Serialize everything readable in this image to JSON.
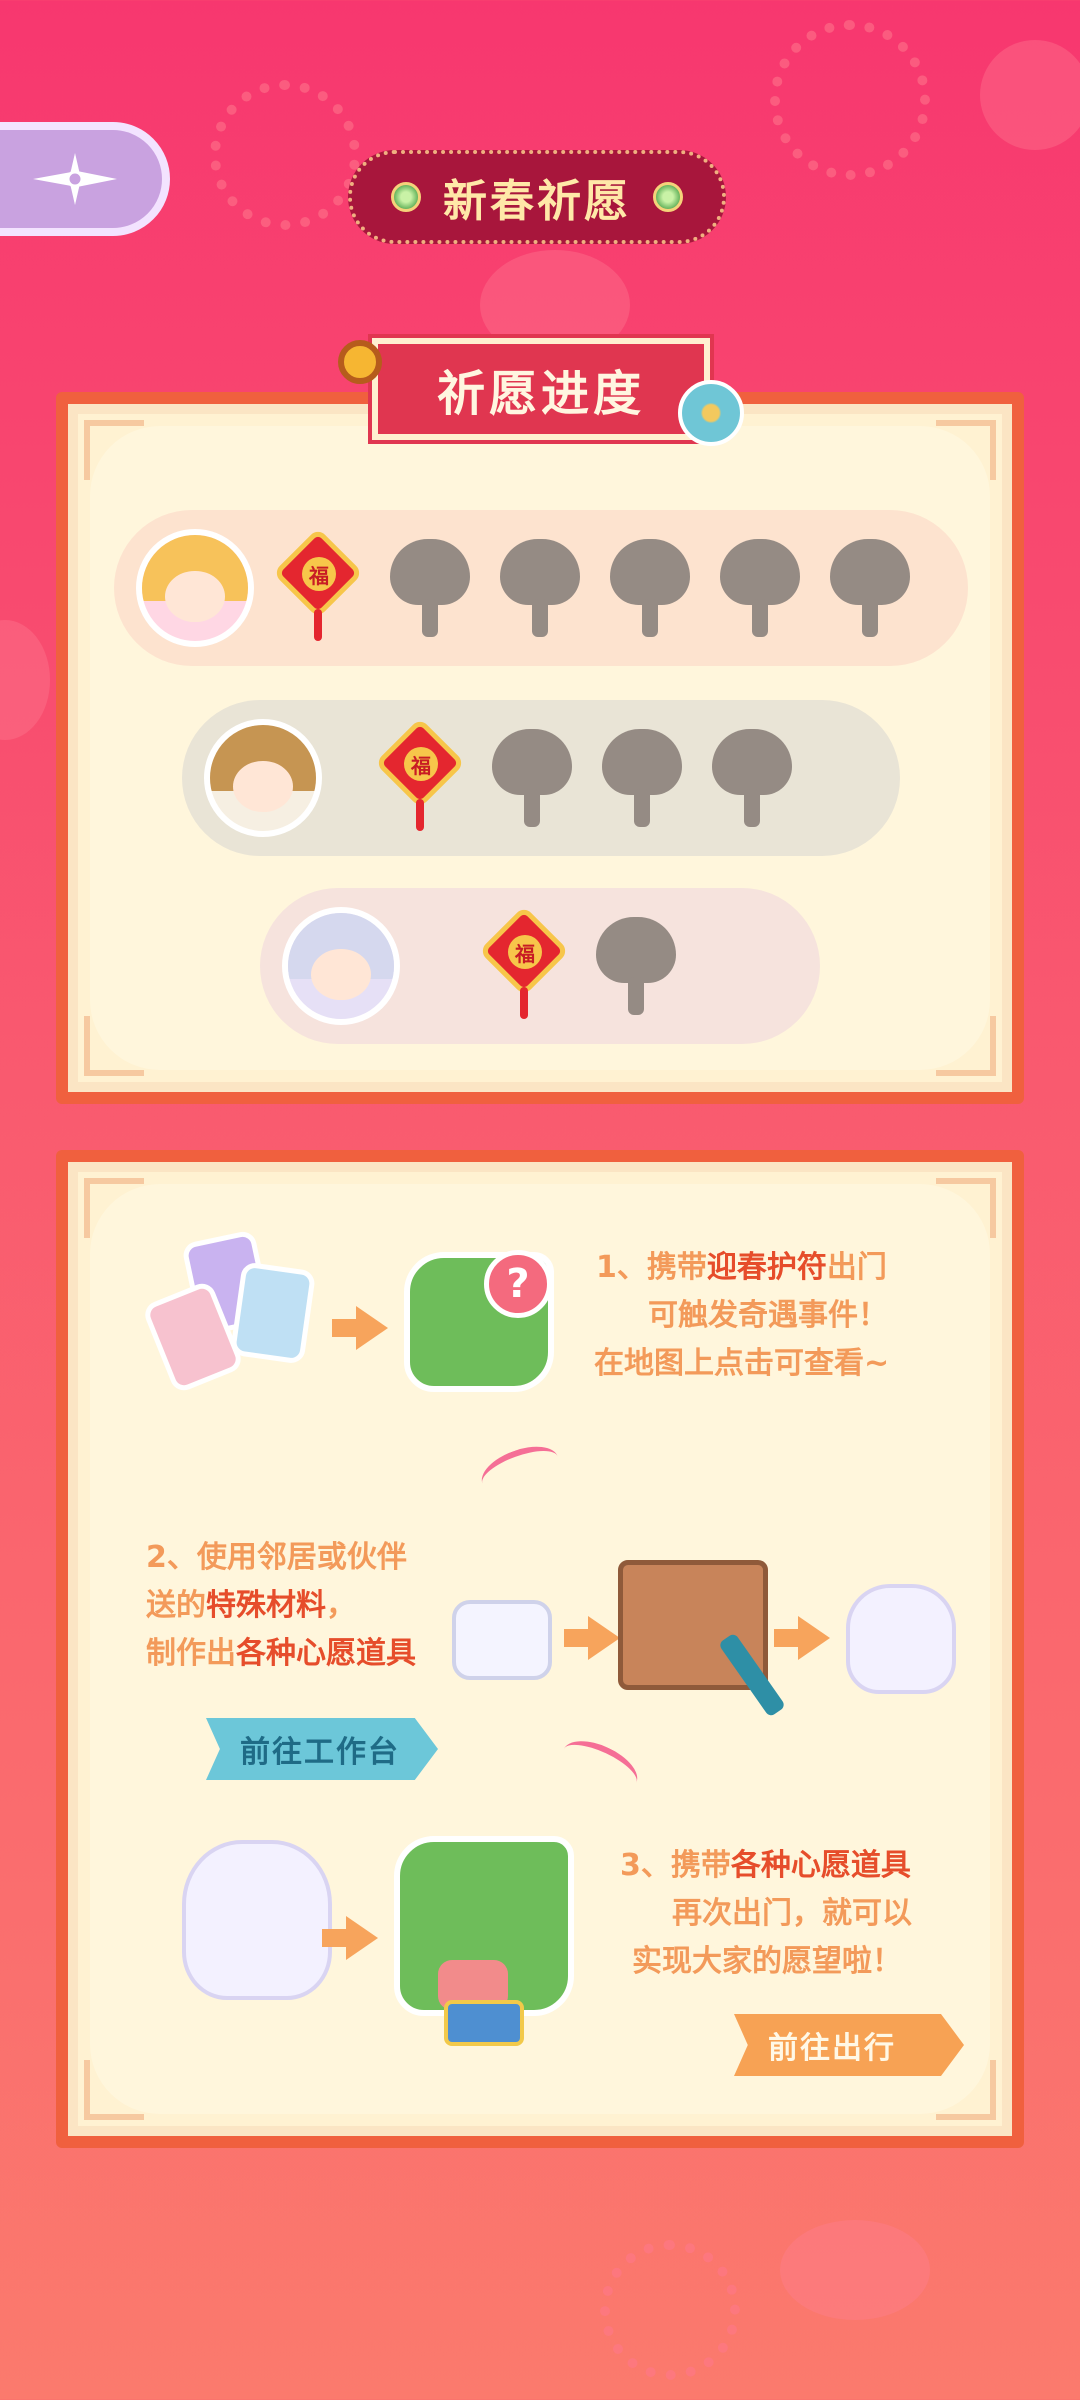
{
  "header": {
    "title": "新春祈愿"
  },
  "progress": {
    "title": "祈愿进度",
    "rows": [
      {
        "name": "blonde-girl",
        "unlocked": 1,
        "locked": 5
      },
      {
        "name": "brown-hair-character",
        "unlocked": 1,
        "locked": 3
      },
      {
        "name": "silver-hair-character",
        "unlocked": 1,
        "locked": 1
      }
    ],
    "knot_char": "福"
  },
  "steps": {
    "step1": {
      "prefix": "1、携带",
      "highlight": "迎春护符",
      "suffix": "出门",
      "line2": "可触发奇遇事件！",
      "line3": "在地图上点击可查看~"
    },
    "step2": {
      "line1": "2、使用邻居或伙伴",
      "line2_prefix": "送的",
      "line2_highlight": "特殊材料",
      "line2_suffix": "，",
      "line3_prefix": "制作出",
      "line3_highlight": "各种心愿道具"
    },
    "step3": {
      "prefix": "3、携带",
      "highlight": "各种心愿道具",
      "line2": "再次出门，就可以",
      "line3": "实现大家的愿望啦！"
    },
    "question_mark": "?"
  },
  "buttons": {
    "workbench": "前往工作台",
    "outing": "前往出行"
  },
  "colors": {
    "accent": "#f0603e",
    "highlight": "#e64d2b",
    "step_text": "#f39a5a"
  },
  "icons": {
    "back": "compass-arrow-icon"
  }
}
